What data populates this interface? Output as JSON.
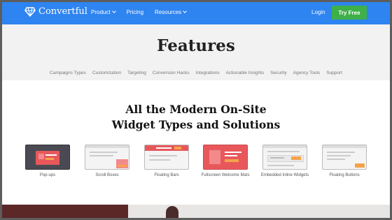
{
  "nav": {
    "brand": "Convertful",
    "items": [
      {
        "label": "Product",
        "dropdown": true
      },
      {
        "label": "Pricing",
        "dropdown": false
      },
      {
        "label": "Resources",
        "dropdown": true
      }
    ],
    "login": "Login",
    "cta": "Try Free"
  },
  "features": {
    "title": "Features",
    "links": [
      "Campaigns Types",
      "Customization",
      "Targeting",
      "Conversion Hacks",
      "Integrations",
      "Actionable Insights",
      "Security",
      "Agency Tools",
      "Support"
    ]
  },
  "widgets": {
    "heading_line1": "All the Modern On-Site",
    "heading_line2": "Widget Types and Solutions",
    "items": [
      {
        "label": "Pop-ups"
      },
      {
        "label": "Scroll Boxes"
      },
      {
        "label": "Floating Bars"
      },
      {
        "label": "Fullscreen Welcome Mats"
      },
      {
        "label": "Embedded Inline Widgets"
      },
      {
        "label": "Floating Buttons"
      }
    ]
  },
  "colors": {
    "nav": "#2e84f0",
    "cta": "#3eb049",
    "accent": "#e8585b",
    "orange": "#f5a34b"
  }
}
